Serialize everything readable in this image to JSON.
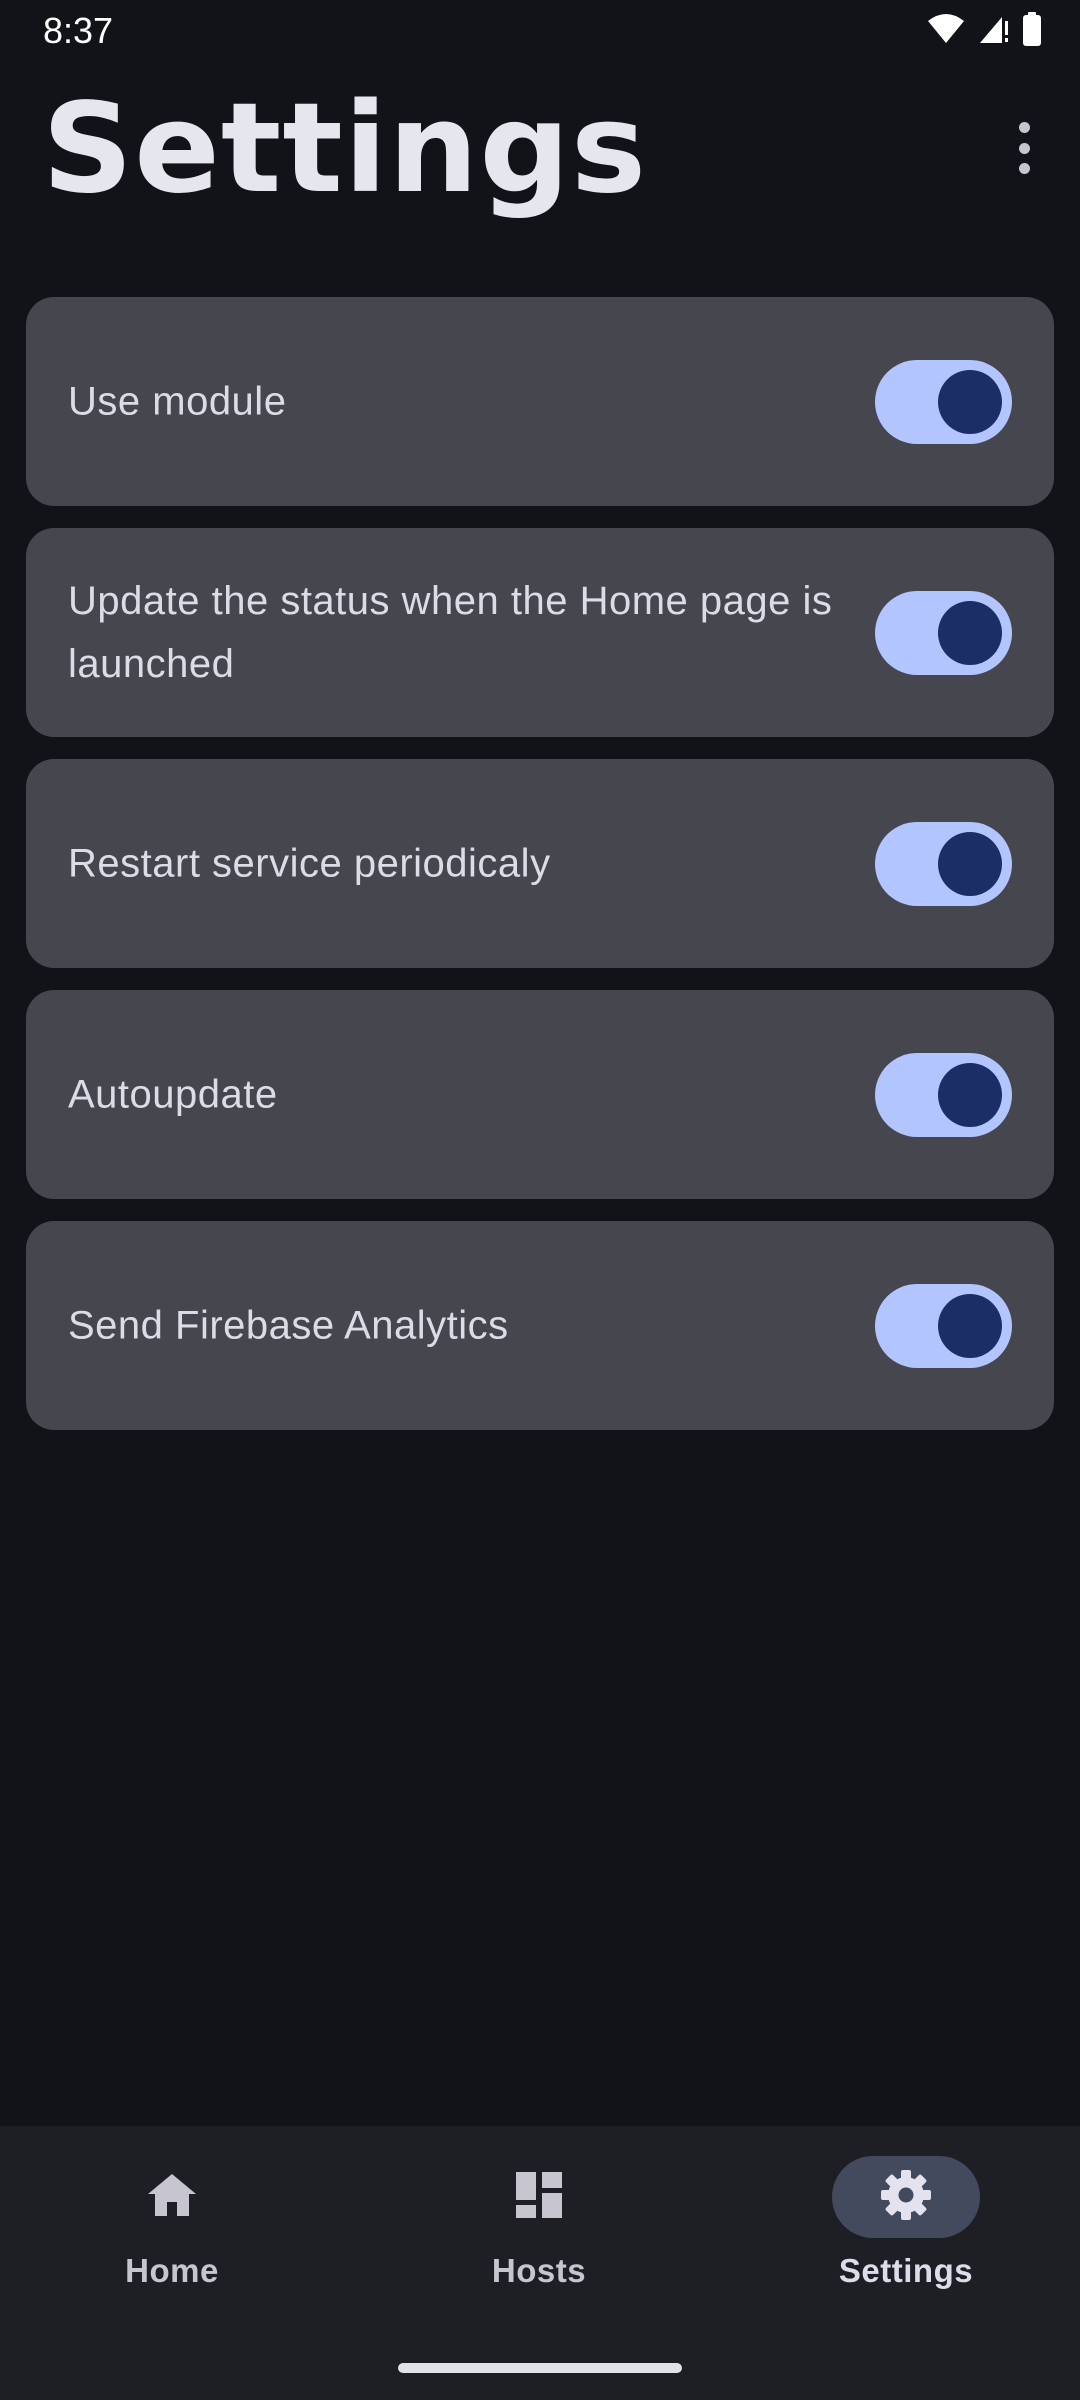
{
  "status_bar": {
    "time": "8:37"
  },
  "header": {
    "title": "Settings"
  },
  "settings": [
    {
      "label": "Use module",
      "enabled": true
    },
    {
      "label": "Update the status when the Home page is launched",
      "enabled": true
    },
    {
      "label": "Restart service periodicaly",
      "enabled": true
    },
    {
      "label": "Autoupdate",
      "enabled": true
    },
    {
      "label": "Send Firebase Analytics",
      "enabled": true
    }
  ],
  "bottom_nav": {
    "items": [
      {
        "label": "Home",
        "icon": "home-icon",
        "active": false
      },
      {
        "label": "Hosts",
        "icon": "dashboard-icon",
        "active": false
      },
      {
        "label": "Settings",
        "icon": "gear-icon",
        "active": true
      }
    ]
  },
  "colors": {
    "background": "#121318",
    "card": "#46464f",
    "switch_track": "#b3c5ff",
    "switch_thumb": "#1b2f66",
    "nav_background": "#1e1f25",
    "nav_active_pill": "#444a5e"
  }
}
